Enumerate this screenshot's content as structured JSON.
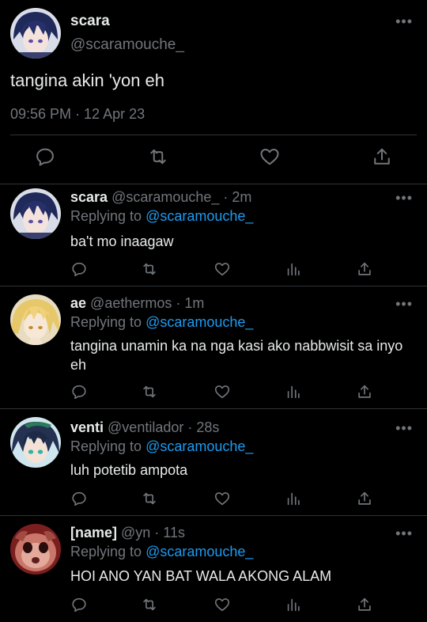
{
  "main_tweet": {
    "name": "scara",
    "handle": "@scaramouche_",
    "text": "tangina akin 'yon eh",
    "timestamp": "09:56 PM · 12 Apr 23",
    "more_icon": "•••"
  },
  "replies": [
    {
      "name": "scara",
      "handle_time": "@scaramouche_ · 2m",
      "replying_prefix": "Replying to ",
      "replying_to": "@scaramouche_",
      "text": "ba't mo inaagaw",
      "more_icon": "•••"
    },
    {
      "name": "ae",
      "handle_time": "@aethermos · 1m",
      "replying_prefix": "Replying to ",
      "replying_to": "@scaramouche_",
      "text": "tangina unamin ka na nga kasi ako nabbwisit sa inyo eh",
      "more_icon": "•••"
    },
    {
      "name": "venti",
      "handle_time": "@ventilador · 28s",
      "replying_prefix": "Replying to ",
      "replying_to": "@scaramouche_",
      "text": "luh potetib ampota",
      "more_icon": "•••"
    },
    {
      "name": "[name]",
      "handle_time": "@yn · 11s",
      "replying_prefix": "Replying to ",
      "replying_to": "@scaramouche_",
      "text": "HOI ANO YAN BAT WALA AKONG ALAM",
      "more_icon": "•••"
    }
  ],
  "colors": {
    "background": "#000000",
    "text": "#e7e9ea",
    "secondary": "#71767b",
    "link": "#1d9bf0",
    "divider": "#2f3336"
  }
}
